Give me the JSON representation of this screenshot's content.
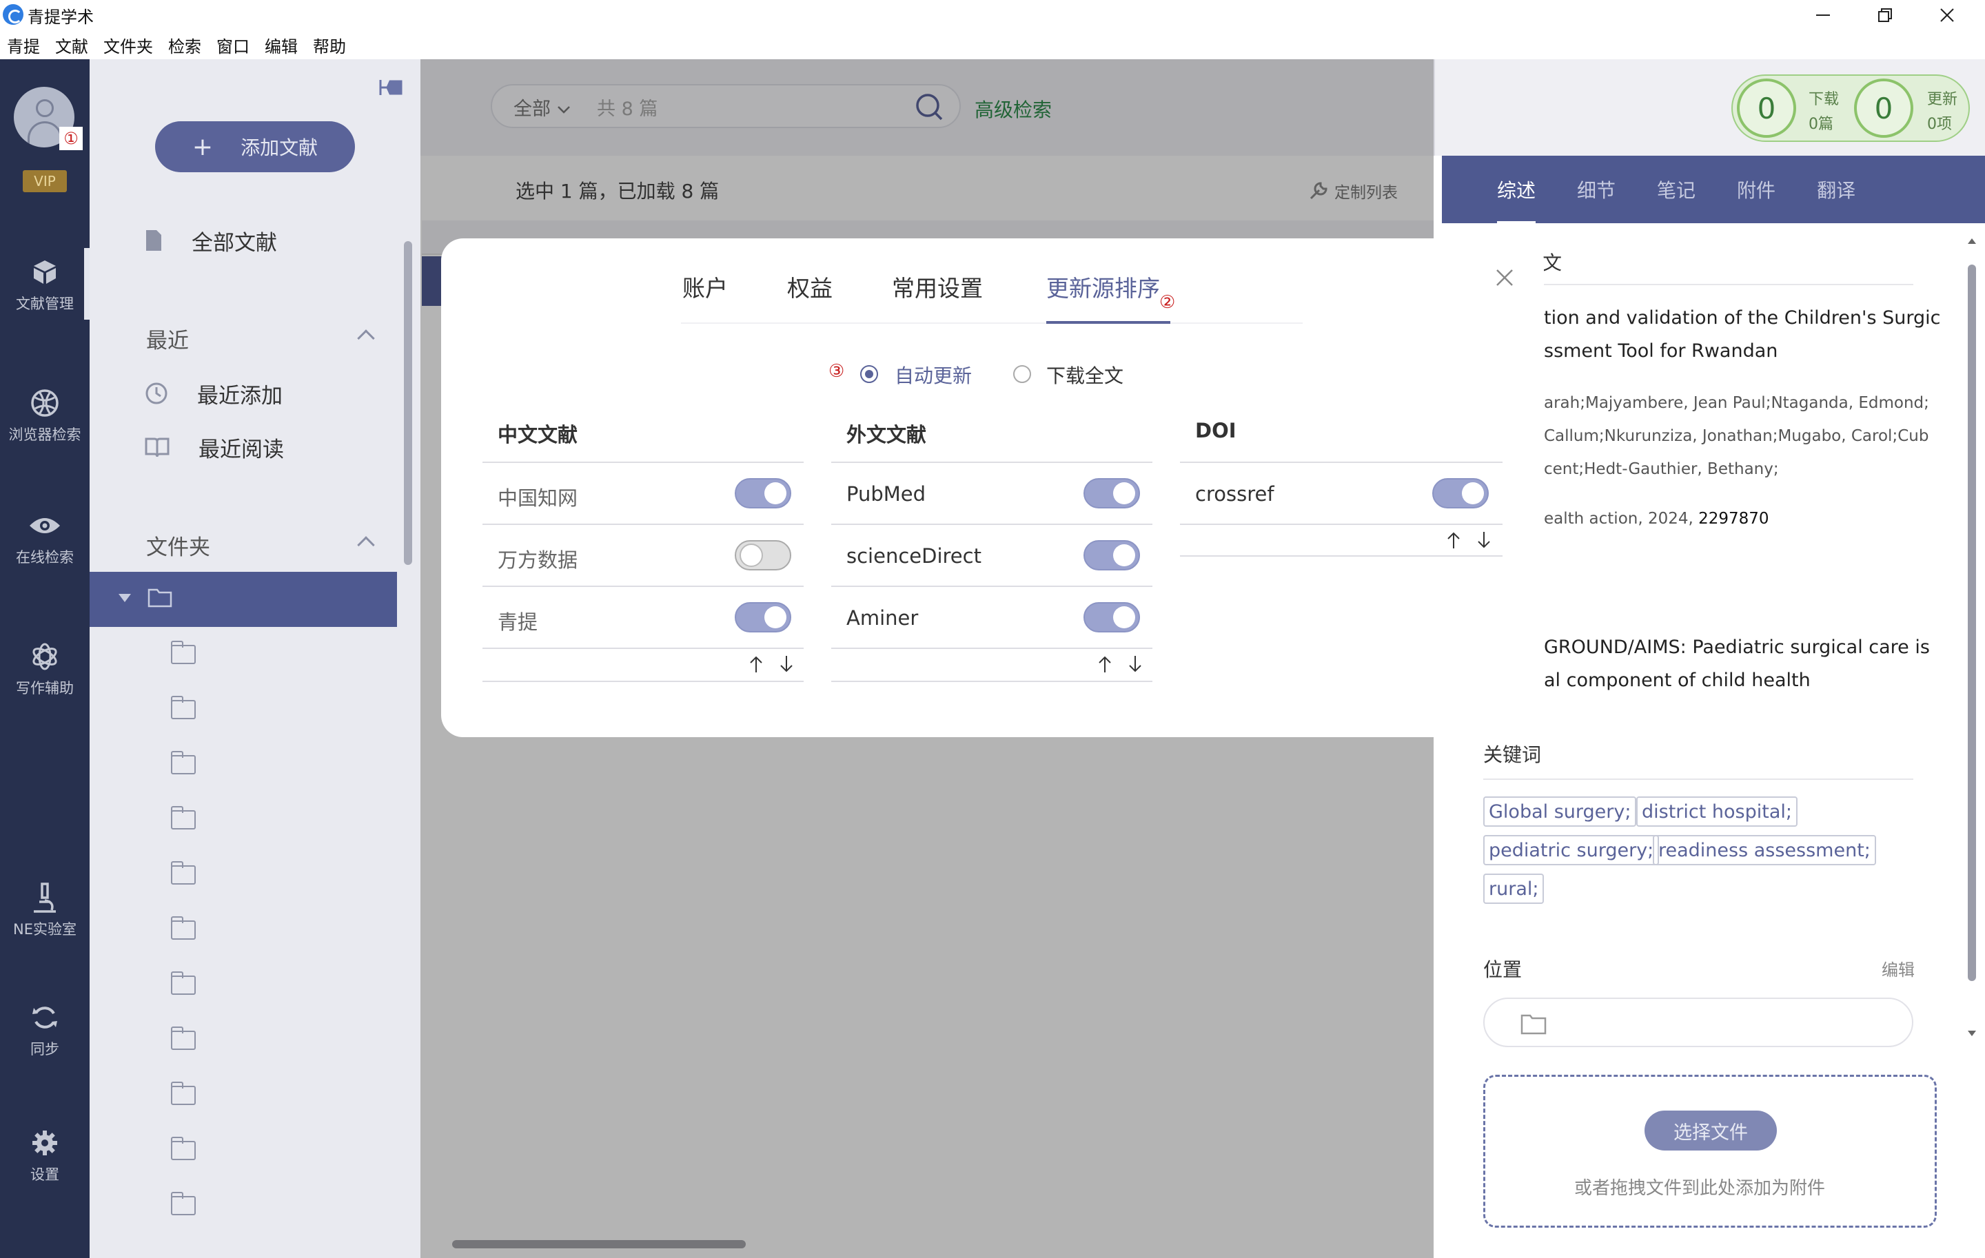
{
  "window": {
    "title": "青提学术"
  },
  "menu": [
    "青提",
    "文献",
    "文件夹",
    "检索",
    "窗口",
    "编辑",
    "帮助"
  ],
  "iconbar": {
    "badge": "①",
    "vip": "VIP",
    "items": [
      {
        "label": "文献管理",
        "icon": "cube-icon"
      },
      {
        "label": "浏览器检索",
        "icon": "globe-icon"
      },
      {
        "label": "在线检索",
        "icon": "eye-icon"
      },
      {
        "label": "写作辅助",
        "icon": "ai-icon"
      },
      {
        "label": "NE实验室",
        "icon": "microscope-icon"
      },
      {
        "label": "同步",
        "icon": "sync-icon"
      },
      {
        "label": "设置",
        "icon": "gear-icon"
      }
    ]
  },
  "folder_panel": {
    "add_button": "添加文献",
    "add_plus": "+",
    "all_docs": "全部文献",
    "recent_section": "最近",
    "recent_added": "最近添加",
    "recent_read": "最近阅读",
    "folders_section": "文件夹"
  },
  "main": {
    "search_scope": "全部",
    "search_placeholder": "共 8 篇",
    "advanced_search": "高级检索",
    "selection_info": "选中 1 篇，已加载 8 篇",
    "custom_list": "定制列表"
  },
  "counters": {
    "download_value": "0",
    "download_label": "下载",
    "download_sub": "0篇",
    "update_value": "0",
    "update_label": "更新",
    "update_sub": "0项"
  },
  "right_panel": {
    "tabs": [
      "综述",
      "细节",
      "笔记",
      "附件",
      "翻译"
    ],
    "section_title": "文",
    "title_line1": "tion and validation of the Children's Surgic",
    "title_line2": "ssment Tool for Rwandan",
    "authors_line1": "arah;Majyambere, Jean Paul;Ntaganda, Edmond;",
    "authors_line2": "Callum;Nkurunziza, Jonathan;Mugabo, Carol;Cub",
    "authors_line3": "cent;Hedt-Gauthier, Bethany;",
    "journal": "ealth action, 2024, ",
    "journal_id": "2297870",
    "abstract_line1": "GROUND/AIMS: Paediatric surgical care is",
    "abstract_line2": "al component of child health",
    "keywords_title": "关键词",
    "keywords": [
      "Global surgery;",
      "district hospital;",
      "pediatric surgery;",
      "readiness assessment;",
      "rural;"
    ],
    "location_title": "位置",
    "location_edit": "编辑",
    "choose_file": "选择文件",
    "attach_hint": "或者拖拽文件到此处添加为附件"
  },
  "modal": {
    "tabs": [
      "账户",
      "权益",
      "常用设置",
      "更新源排序"
    ],
    "badge2": "②",
    "badge3": "③",
    "radio_auto": "自动更新",
    "radio_download": "下载全文",
    "columns": [
      {
        "title": "中文文献",
        "sources": [
          {
            "name": "中国知网",
            "on": true
          },
          {
            "name": "万方数据",
            "on": false
          },
          {
            "name": "青提",
            "on": true
          }
        ]
      },
      {
        "title": "外文文献",
        "sources": [
          {
            "name": "PubMed",
            "on": true
          },
          {
            "name": "scienceDirect",
            "on": true
          },
          {
            "name": "Aminer",
            "on": true
          }
        ]
      },
      {
        "title": "DOI",
        "sources": [
          {
            "name": "crossref",
            "on": true
          }
        ]
      }
    ],
    "up_arrow": "↑",
    "down_arrow": "↓"
  },
  "colors": {
    "accent": "#5a6399",
    "sidebar": "#27304e",
    "badge": "#c81e1e"
  }
}
